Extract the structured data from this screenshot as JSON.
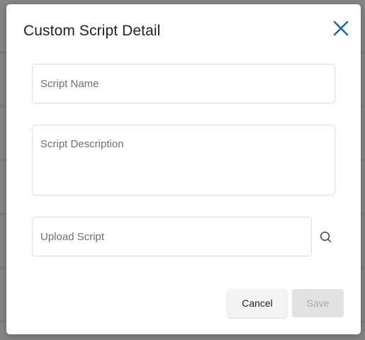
{
  "dialog": {
    "title": "Custom Script Detail",
    "close_icon": "close-icon"
  },
  "form": {
    "script_name_placeholder": "Script Name",
    "script_name_value": "",
    "script_description_placeholder": "Script Description",
    "script_description_value": "",
    "upload_script_placeholder": "Upload Script",
    "upload_script_value": "",
    "browse_icon": "search-icon"
  },
  "actions": {
    "cancel_label": "Cancel",
    "save_label": "Save",
    "save_enabled": false
  },
  "colors": {
    "accent": "#1a6aa8",
    "cancel_bg": "#f3f3f3",
    "save_disabled_bg": "#e2e2e2",
    "save_disabled_text": "#a9a9a9"
  }
}
